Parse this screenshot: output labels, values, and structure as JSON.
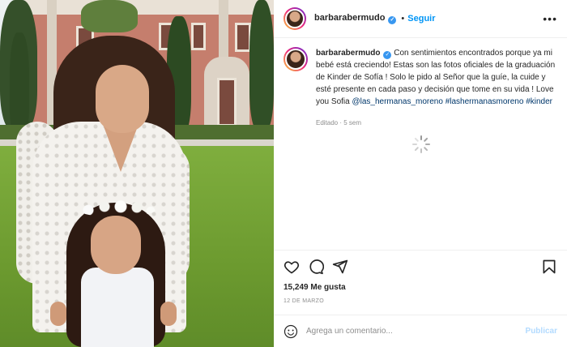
{
  "post": {
    "username": "barbarabermudo",
    "follow_label": "Seguir",
    "more_label": "•••",
    "verified_glyph": "✓",
    "dot_sep": "•"
  },
  "caption": {
    "username": "barbarabermudo",
    "text": "Con sentimientos encontrados porque ya mi bebé está creciendo! Estas son las fotos oficiales de la graduación de Kinder de Sofía ! Solo le pido al Señor que la guíe, la cuide y esté presente en cada paso y decisión que tome en su vida ! Love you Sofia ",
    "tags": [
      "@las_hermanas_moreno",
      "#lashermanasmoreno",
      "#kinder"
    ],
    "meta": "Editado · 5 sem"
  },
  "icons": {
    "like": "heart-icon",
    "comment": "comment-icon",
    "share": "share-icon",
    "save": "bookmark-icon",
    "emoji": "emoji-icon",
    "spinner": "loading-spinner-icon"
  },
  "stats": {
    "likes": "15,249 Me gusta",
    "date": "12 DE MARZO"
  },
  "comment_box": {
    "placeholder": "Agrega un comentario...",
    "publish_label": "Publicar"
  },
  "colors": {
    "accent": "#0095f6",
    "publish_disabled": "#b3dbff",
    "tag": "#00376b",
    "verified": "#3897f0"
  }
}
